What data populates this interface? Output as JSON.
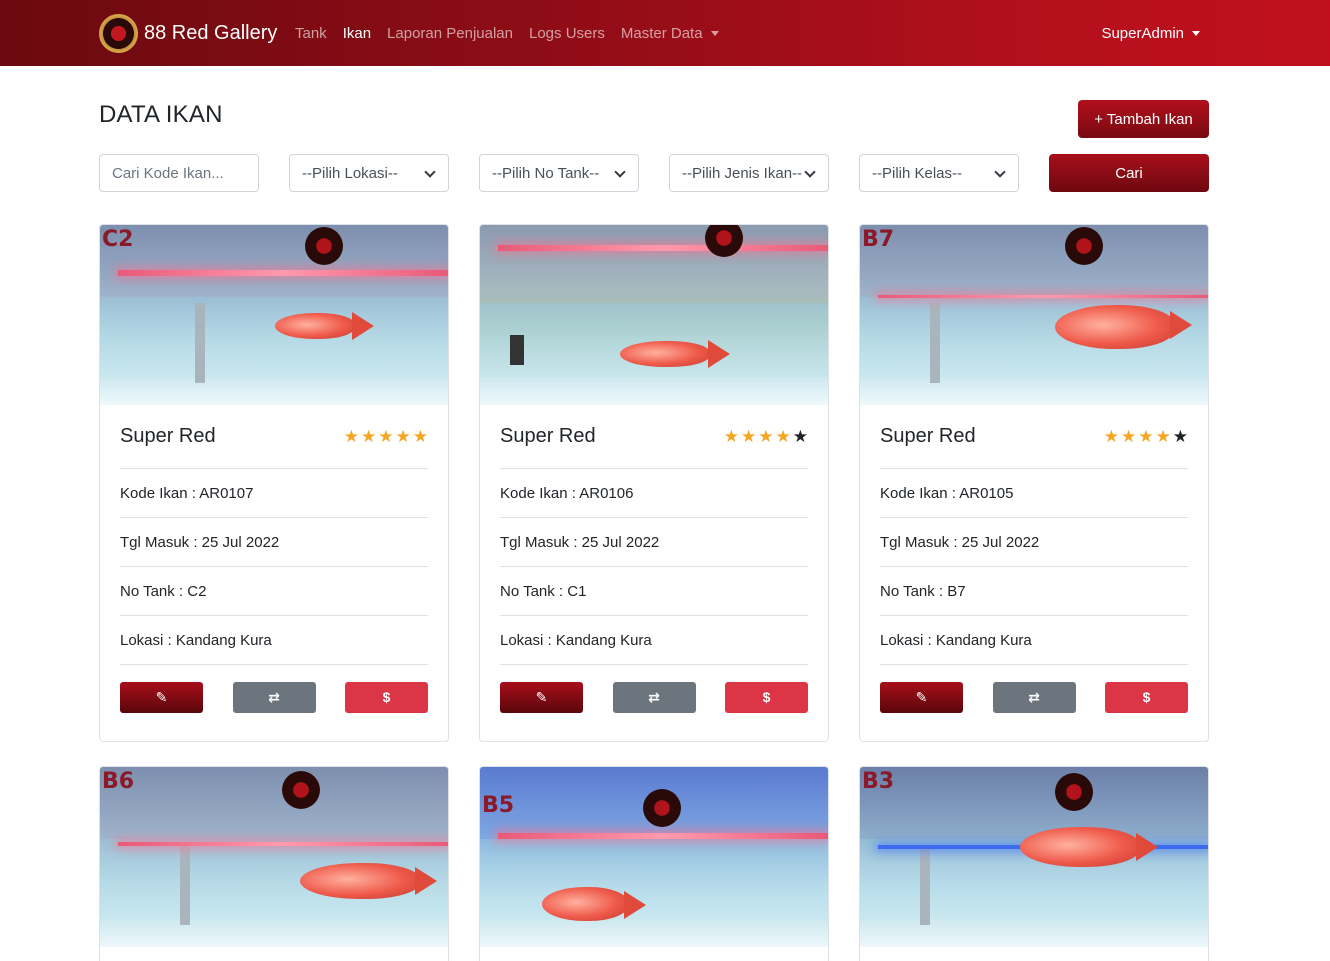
{
  "navbar": {
    "brand": "88 Red Gallery",
    "links": [
      "Tank",
      "Ikan",
      "Laporan Penjualan",
      "Logs Users",
      "Master Data"
    ],
    "active": "Ikan",
    "user": "SuperAdmin"
  },
  "page": {
    "title": "DATA IKAN",
    "add_button": "+ Tambah Ikan"
  },
  "filters": {
    "search_placeholder": "Cari Kode Ikan...",
    "lokasi": "--Pilih Lokasi--",
    "no_tank": "--Pilih No Tank--",
    "jenis_ikan": "--Pilih Jenis Ikan--",
    "kelas": "--Pilih Kelas--",
    "search_button": "Cari"
  },
  "colors": {
    "brand": "#a70e1a",
    "star": "#f5a623",
    "sell": "#dc3545",
    "move": "#6c757d"
  },
  "cards": [
    {
      "tank_tag": "C2",
      "name": "Super Red",
      "rating": 5,
      "kode": "Kode Ikan : AR0107",
      "tgl": "Tgl Masuk : 25 Jul 2022",
      "tank": "No Tank : C2",
      "lokasi": "Lokasi : Kandang Kura"
    },
    {
      "tank_tag": "",
      "name": "Super Red",
      "rating": 4,
      "kode": "Kode Ikan : AR0106",
      "tgl": "Tgl Masuk : 25 Jul 2022",
      "tank": "No Tank : C1",
      "lokasi": "Lokasi : Kandang Kura"
    },
    {
      "tank_tag": "B7",
      "name": "Super Red",
      "rating": 4,
      "kode": "Kode Ikan : AR0105",
      "tgl": "Tgl Masuk : 25 Jul 2022",
      "tank": "No Tank : B7",
      "lokasi": "Lokasi : Kandang Kura"
    },
    {
      "tank_tag": "B6"
    },
    {
      "tank_tag": "B5"
    },
    {
      "tank_tag": "B3"
    }
  ],
  "actions": {
    "edit_icon": "edit-icon",
    "move_icon": "exchange-icon",
    "sell_label": "$"
  }
}
